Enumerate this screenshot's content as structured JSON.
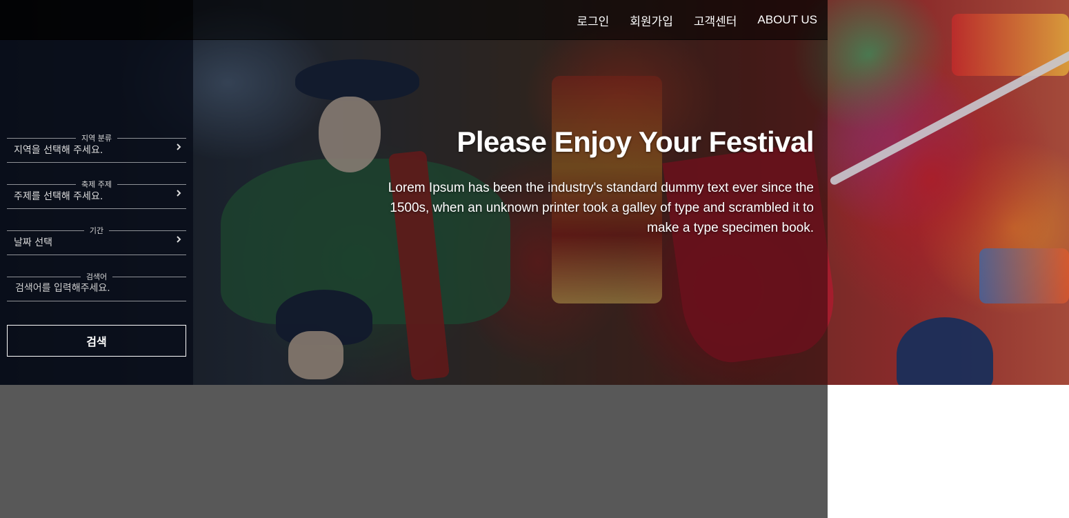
{
  "nav": {
    "login": "로그인",
    "signup": "회원가입",
    "support": "고객센터",
    "about": "ABOUT US"
  },
  "search_panel": {
    "region": {
      "label": "지역 분류",
      "value": "지역을 선택해 주세요."
    },
    "theme": {
      "label": "축제 주제",
      "value": "주제를 선택해 주세요."
    },
    "period": {
      "label": "기간",
      "value": "날짜 선택"
    },
    "keyword": {
      "label": "검색어",
      "placeholder": "검색어를 입력해주세요."
    },
    "submit_label": "검색"
  },
  "hero": {
    "title": "Please Enjoy Your Festival",
    "description": "Lorem Ipsum has been the industry's standard dummy text ever since the 1500s, when an unknown printer took a galley of type and scrambled it to make a type specimen book."
  },
  "colors": {
    "panel_bg": "#080e1a",
    "below_hero_gray": "#585858",
    "text": "#ffffff"
  },
  "icons": {
    "field_arrow": "chevron-right-icon"
  }
}
